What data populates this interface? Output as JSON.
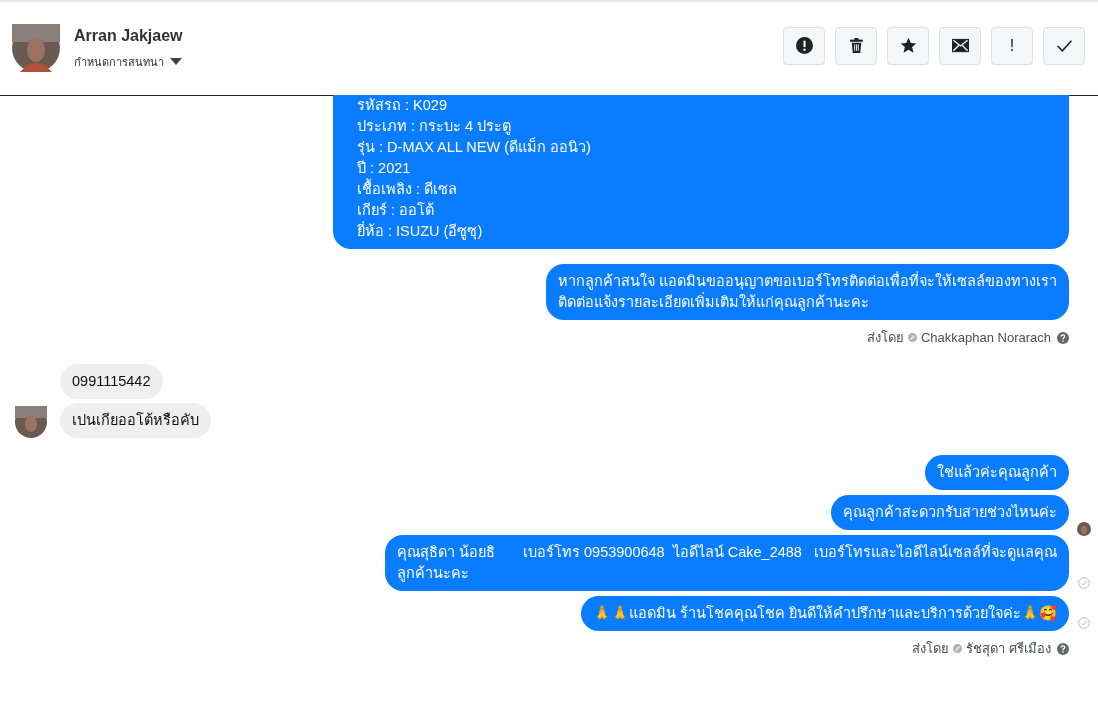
{
  "header": {
    "contact_name": "Arran Jakjaew",
    "subtitle": "กำหนดการสนทนา",
    "actions": [
      {
        "kind": "alert"
      },
      {
        "kind": "trash"
      },
      {
        "kind": "star"
      },
      {
        "kind": "mail"
      },
      {
        "kind": "text",
        "label": "!"
      },
      {
        "kind": "check"
      }
    ]
  },
  "messages": [
    {
      "kind": "outgoing",
      "continued_above": true,
      "lines": [
        "รหัสรถ : K029",
        "ประเภท : กระบะ 4 ประตู",
        "รุ่น : D-MAX ALL NEW (ดีแม็ก ออนิว)",
        "ปี : 2021",
        "เชื้อเพลิง : ดีเซล",
        "เกียร์ : ออโต้",
        "ยี่ห้อ : ISUZU (อีซูซุ)"
      ]
    },
    {
      "kind": "outgoing",
      "lines": [
        "หากลูกค้าสนใจ แอดมินขออนุญาตขอเบอร์โทรติดต่อเพื่อที่จะให้เซลล์ของทางเรา",
        "ติดต่อแจ้งรายละเอียดเพิ่มเติมให้แก่คุณลูกค้านะคะ"
      ]
    },
    {
      "kind": "sent_by",
      "label": "ส่งโดย",
      "name": "Chakkaphan Norarach"
    },
    {
      "kind": "incoming",
      "avatar": false,
      "lines": [
        "0991115442"
      ]
    },
    {
      "kind": "incoming",
      "avatar": true,
      "lines": [
        "เปนเกียออโต้หรือคับ"
      ]
    },
    {
      "kind": "outgoing",
      "lines": [
        "ใช่แล้วค่ะคุณลูกค้า"
      ]
    },
    {
      "kind": "outgoing",
      "seen_avatar": true,
      "lines": [
        "คุณลูกค้าสะดวกรับสายช่วงไหนค่ะ"
      ]
    },
    {
      "kind": "outgoing",
      "sent_check": true,
      "lines": [
        "คุณสุธิดา น้อยธิ       เบอร์โทร 0953900648  ไอดีไลน์ Cake_2488   เบอร์โทรและไอดีไลน์เซลล์ที่จะดูแลคุณ",
        "ลูกค้านะคะ"
      ]
    },
    {
      "kind": "outgoing",
      "sent_check": true,
      "lines": [
        "🙏🙏แอดมิน ร้านโชคคุณโชค ยินดีให้คำปรึกษาและบริการด้วยใจค่ะ🙏🥰"
      ]
    },
    {
      "kind": "sent_by",
      "label": "ส่งโดย",
      "name": "รัชสุดา ศรีเมือง"
    }
  ]
}
